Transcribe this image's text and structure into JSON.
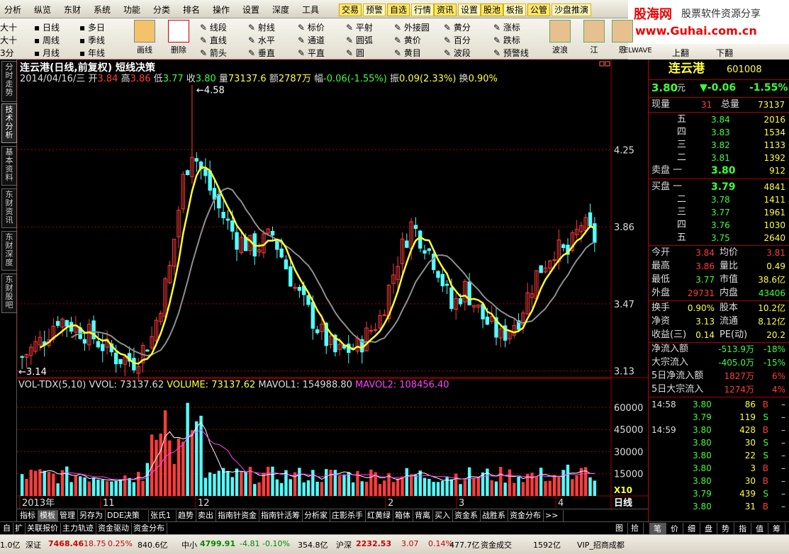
{
  "menu": {
    "items": [
      "分析",
      "纵览",
      "东财",
      "系统",
      "功能",
      "分类",
      "排名",
      "操作",
      "设置",
      "深度",
      "工具"
    ],
    "buttons": [
      "交易",
      "预警",
      "自选",
      "行情",
      "资讯",
      "设置",
      "股池",
      "板指",
      "公管",
      "沙盘推演"
    ]
  },
  "banner": {
    "title": "股海网",
    "subtitle": "股票软件资源分享",
    "url": "www.Guhai.com.cn"
  },
  "toolbar": {
    "rows": [
      [
        "大十",
        "日线",
        "多日"
      ],
      [
        "大十",
        "周线",
        "季线"
      ],
      [
        "3分",
        "月线",
        "年线"
      ]
    ],
    "draw_tools": [
      "画线",
      "删除"
    ],
    "line_tools": [
      [
        "线段",
        "射线",
        "标价",
        "平射",
        "外接圆",
        "黄分",
        "涨标"
      ],
      [
        "直线",
        "水平",
        "通道",
        "圆弧",
        "黄价",
        "百分",
        "跌标"
      ],
      [
        "箭头",
        "垂直",
        "平直",
        "圆",
        "黄目",
        "波段",
        "预警线"
      ]
    ],
    "right_tools": [
      "波浪",
      "江",
      "恩",
      "ELWAVE"
    ],
    "page_tools": [
      "上翻",
      "下翻"
    ]
  },
  "vtabs": [
    "分时走势",
    "技术分析",
    "基本资料",
    "东财资讯",
    "东财深度",
    "东财股吧"
  ],
  "chart": {
    "title": "连云港(日线,前复权) 短线决策",
    "info": {
      "date": "2014/04/16/三",
      "open_label": "开",
      "open": "3.84",
      "high_label": "高",
      "high": "3.86",
      "low_label": "低",
      "low": "3.77",
      "close_label": "收",
      "close": "3.80",
      "vol_label": "量",
      "vol": "73137.6",
      "amt_label": "额",
      "amt": "2787万",
      "chg_label": "幅",
      "chg": "-0.06(-1.55%)",
      "amp_label": "振",
      "amp": "0.09(2.33%)",
      "turn_label": "换",
      "turn": "0.90%"
    },
    "high_marker": "4.58",
    "low_marker": "3.14",
    "price_ticks": [
      "4.25",
      "3.86",
      "3.47",
      "3.13"
    ],
    "vol_info": {
      "name": "VOL-TDX(5,10)",
      "vvol_label": "VVOL:",
      "vvol": "73137.62",
      "volume_label": "VOLUME:",
      "volume": "73137.62",
      "mavol1_label": "MAVOL1:",
      "mavol1": "154988.80",
      "mavol2_label": "MAVOL2:",
      "mavol2": "108456.40"
    },
    "vol_ticks": [
      "60000",
      "45000",
      "30000",
      "15000"
    ],
    "vol_unit": "X10",
    "date_labels": [
      "2013年",
      "11",
      "12",
      "2",
      "3",
      "4"
    ],
    "period": "日线"
  },
  "chart_data": {
    "type": "candlestick",
    "title": "连云港(日线,前复权) 短线决策",
    "y_range": [
      3.1,
      4.6
    ],
    "last": {
      "open": 3.84,
      "high": 3.86,
      "low": 3.77,
      "close": 3.8,
      "volume": 73137.62
    },
    "markers": {
      "high": 4.58,
      "low": 3.14
    },
    "vol_range": [
      0,
      70000
    ],
    "mavol1": 154988.8,
    "mavol2": 108456.4
  },
  "bottom_tabs": [
    "指标",
    "模板",
    "管理",
    "另存为",
    "DDE决策",
    "张氏1",
    "趋势",
    "卖出",
    "指南针资金",
    "指南针活筹",
    "分析家",
    "庄影杀手",
    "红黄绿",
    "箱体",
    "背离",
    "买入",
    "资金系",
    "战胜系",
    "资金分布",
    ">>"
  ],
  "bottom_tabs2": [
    "自",
    "扩",
    "关联报价",
    "主力轨迹",
    "资金驱动",
    "资金分布"
  ],
  "bottom_tabs2_right": [
    "图",
    "拾"
  ],
  "status": {
    "items": [
      "1.0亿",
      "深证",
      "7468.46",
      "18.75",
      "0.25%",
      "840.6亿",
      "中小",
      "4799.91",
      "-4.81",
      "-0.10%",
      "354.8亿",
      "沪深",
      "2232.53",
      "3.07",
      "0.14%",
      "477.7亿",
      "资金成交",
      "1592亿",
      "VIP_招商成都"
    ]
  },
  "quote": {
    "name": "连云港",
    "code": "601008",
    "price": "3.80",
    "price_unit": "元",
    "change": "▼-0.06",
    "change_pct": "-1.55%",
    "now_vol_label": "现量",
    "now_vol": "31",
    "total_vol_label": "总量",
    "total_vol": "73137",
    "asks": [
      {
        "label": "五",
        "price": "3.84",
        "vol": "2016"
      },
      {
        "label": "四",
        "price": "3.83",
        "vol": "1534"
      },
      {
        "label": "三",
        "price": "3.82",
        "vol": "1133"
      },
      {
        "label": "二",
        "price": "3.81",
        "vol": "1392"
      },
      {
        "label": "卖盘 一",
        "price": "3.80",
        "vol": "912"
      }
    ],
    "bids": [
      {
        "label": "买盘 一",
        "price": "3.79",
        "vol": "4841"
      },
      {
        "label": "二",
        "price": "3.78",
        "vol": "1411"
      },
      {
        "label": "三",
        "price": "3.77",
        "vol": "1961"
      },
      {
        "label": "四",
        "price": "3.76",
        "vol": "1030"
      },
      {
        "label": "五",
        "price": "3.75",
        "vol": "2640"
      }
    ],
    "stats": [
      {
        "l1": "今开",
        "v1": "3.84",
        "l2": "均价",
        "v2": "3.81"
      },
      {
        "l1": "最高",
        "v1": "3.86",
        "l2": "量比",
        "v2": "0.49"
      },
      {
        "l1": "最低",
        "v1": "3.77",
        "l2": "市值",
        "v2": "38.6亿"
      },
      {
        "l1": "外盘",
        "v1": "29731",
        "l2": "内盘",
        "v2": "43406"
      }
    ],
    "stats2": [
      {
        "l1": "换手",
        "v1": "0.90%",
        "l2": "股本",
        "v2": "10.2亿"
      },
      {
        "l1": "净资",
        "v1": "3.13",
        "l2": "流通",
        "v2": "8.12亿"
      },
      {
        "l1": "收益(三)",
        "v1": "0.14",
        "l2": "PE(动)",
        "v2": "20.2"
      }
    ],
    "flows": [
      {
        "label": "净流入额",
        "val": "-513.9万",
        "pct": "-18%"
      },
      {
        "label": "大宗流入",
        "val": "-405.0万",
        "pct": "-15%"
      },
      {
        "label": "5日净流入额",
        "val": "1827万",
        "pct": "6%"
      },
      {
        "label": "5日大宗流入",
        "val": "1274万",
        "pct": "4%"
      }
    ],
    "ticks": [
      {
        "time": "14:58",
        "price": "3.80",
        "vol": "86",
        "bs": "B"
      },
      {
        "time": "",
        "price": "3.79",
        "vol": "119",
        "bs": "S"
      },
      {
        "time": "14:59",
        "price": "3.80",
        "vol": "428",
        "bs": "B"
      },
      {
        "time": "",
        "price": "3.80",
        "vol": "30",
        "bs": "S"
      },
      {
        "time": "",
        "price": "3.80",
        "vol": "22",
        "bs": "S"
      },
      {
        "time": "",
        "price": "3.80",
        "vol": "3",
        "bs": "B"
      },
      {
        "time": "",
        "price": "3.80",
        "vol": "30",
        "bs": "B"
      },
      {
        "time": "",
        "price": "3.79",
        "vol": "439",
        "bs": "S"
      },
      {
        "time": "",
        "price": "3.80",
        "vol": "31",
        "bs": "B"
      }
    ],
    "tabs": [
      "笔",
      "价",
      "细",
      "盘",
      "势",
      "指",
      "值",
      "筹"
    ]
  },
  "colors": {
    "up": "#ff3c3c",
    "down": "#54ffff",
    "ma_yellow": "#ffff30",
    "ma_gray": "#909090",
    "grid": "#a00000"
  }
}
